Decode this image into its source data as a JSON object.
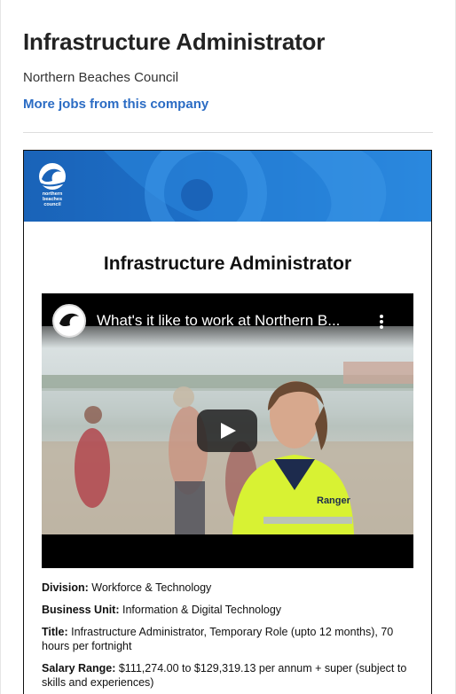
{
  "header": {
    "job_title": "Infrastructure Administrator",
    "company": "Northern Beaches Council",
    "more_jobs_link": "More jobs from this company"
  },
  "ad": {
    "logo_text": "northern beaches council",
    "heading": "Infrastructure Administrator",
    "video": {
      "title": "What's it like to work at Northern B...",
      "menu_icon": "kebab-icon",
      "play_icon": "play-icon",
      "vest_text": "Ranger"
    },
    "details": [
      {
        "label": "Division:",
        "value": "Workforce & Technology"
      },
      {
        "label": "Business Unit:",
        "value": "Information & Digital Technology"
      },
      {
        "label": "Title:",
        "value": "Infrastructure Administrator, Temporary Role (upto 12 months), 70 hours per fortnight"
      },
      {
        "label": "Salary Range:",
        "value": "$111,274.00 to $129,319.13 per annum + super (subject to skills and experiences)"
      }
    ]
  },
  "colors": {
    "link": "#2b6cc4",
    "banner_blue": "#1e73cc",
    "vest_yellow": "#d8f233"
  }
}
